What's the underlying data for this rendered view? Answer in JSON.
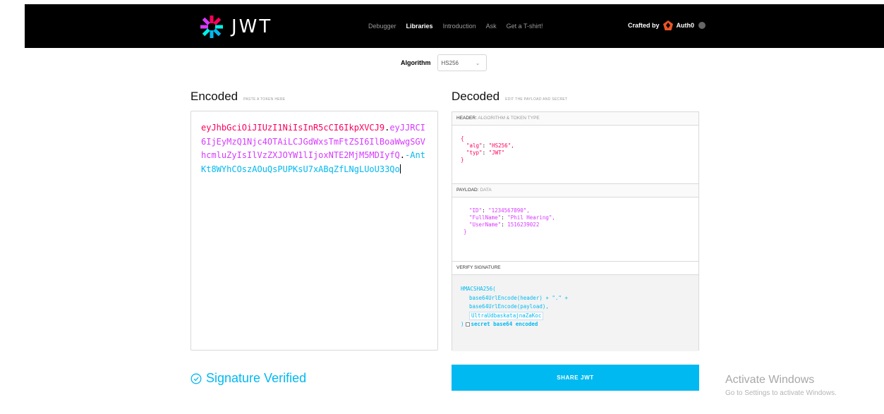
{
  "brand": {
    "name": "JWT"
  },
  "nav": {
    "items": [
      "Debugger",
      "Libraries",
      "Introduction",
      "Ask",
      "Get a T-shirt!"
    ],
    "active": "Libraries"
  },
  "crafted": {
    "prefix": "Crafted by",
    "brand": "Auth0"
  },
  "algorithm": {
    "label": "Algorithm",
    "selected": "HS256"
  },
  "encoded": {
    "title": "Encoded",
    "subtitle": "PASTE A TOKEN HERE",
    "header_part": "eyJhbGciOiJIUzI1NiIsInR5cCI6IkpXVCJ9",
    "payload_part": "eyJJRCI6IjEyMzQ1Njc4OTAiLCJGdWxsTmFtZSI6IlBoaWwgSGVhcmluZyIsIlVzZXJOYW1lIjoxNTE2MjM5MDIyfQ",
    "signature_part": "-AntKt8WYhCOszAOuQsPUPKsU7xABqZfLNgLUoU33Qo",
    "dot": "."
  },
  "decoded": {
    "title": "Decoded",
    "subtitle": "EDIT THE PAYLOAD AND SECRET",
    "header": {
      "label": "HEADER:",
      "sublabel": "ALGORITHM & TOKEN TYPE",
      "open": "{",
      "line1_key": "\"alg\"",
      "line1_val": "\"HS256\",",
      "line2_key": "\"typ\"",
      "line2_val": "\"JWT\"",
      "close": "}"
    },
    "payload": {
      "label": "PAYLOAD:",
      "sublabel": "DATA",
      "line1_key": "\"ID\"",
      "line1_val": "\"1234567890\",",
      "line2_key": "\"FullName\"",
      "line2_val": "\"Phil Hearing\",",
      "line3_key": "\"UserName\"",
      "line3_val": "1516239022",
      "close": "}"
    },
    "verify": {
      "label": "VERIFY SIGNATURE",
      "line1": "HMACSHA256(",
      "line2": "base64UrlEncode(header) + \".\" +",
      "line3": "base64UrlEncode(payload),",
      "secret": "UltraUdbaskatajnaZaKoc",
      "close": ")",
      "checkbox_label": "secret base64 encoded"
    }
  },
  "signature_status": "Signature Verified",
  "share_button": "SHARE JWT",
  "watermark": {
    "title": "Activate Windows",
    "subtitle": "Go to Settings to activate Windows."
  },
  "colors": {
    "accent": "#00b9f1",
    "header_token": "#fb015b",
    "payload_token": "#d63aff"
  }
}
